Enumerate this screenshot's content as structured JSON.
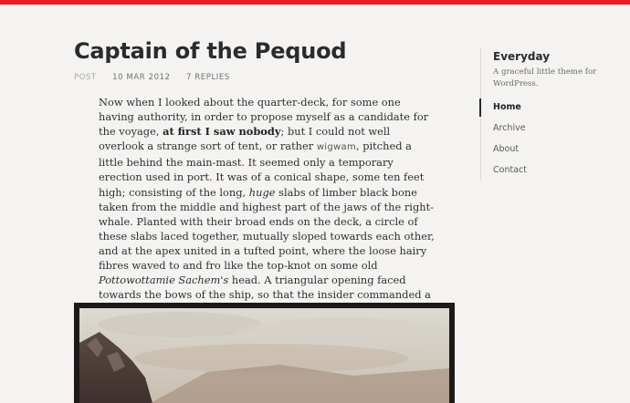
{
  "colors": {
    "accent_bar": "#ee1b24",
    "background": "#f4f3f1",
    "text": "#2f2f2f"
  },
  "post": {
    "title": "Captain of the Pequod",
    "meta": {
      "type": "POST",
      "date": "10 MAR 2012",
      "replies": "7 REPLIES"
    },
    "body": {
      "t1": "Now when I looked about the quarter-deck, for some one having authority, in order to propose myself as a candidate for the voyage, ",
      "b1": "at first I saw nobody",
      "t2": "; but I could not well overlook a strange sort of tent, or rather ",
      "abbr": "wigwam",
      "t3": ", pitched a little behind the main-mast. It seemed only a temporary erection used in port. It was of a conical shape, some ten feet high; consisting of the long, ",
      "i1": "huge",
      "t4": " slabs of limber black bone taken from the middle and highest part of the jaws of the right-whale. Planted with their broad ends on the deck, a circle of these slabs laced together, mutually sloped towards each other, and at the apex united in a tufted point, where the loose hairy fibres waved to and fro like the top-knot on some old ",
      "i2": "Pottowottamie Sachem's",
      "t5": " head. A triangular opening faced towards the bows of the ship, so that the insider commanded a complete view forward."
    }
  },
  "sidebar": {
    "site_title": "Everyday",
    "site_description": "A graceful little theme for WordPress.",
    "nav": [
      "Home",
      "Archive",
      "About",
      "Contact"
    ]
  }
}
